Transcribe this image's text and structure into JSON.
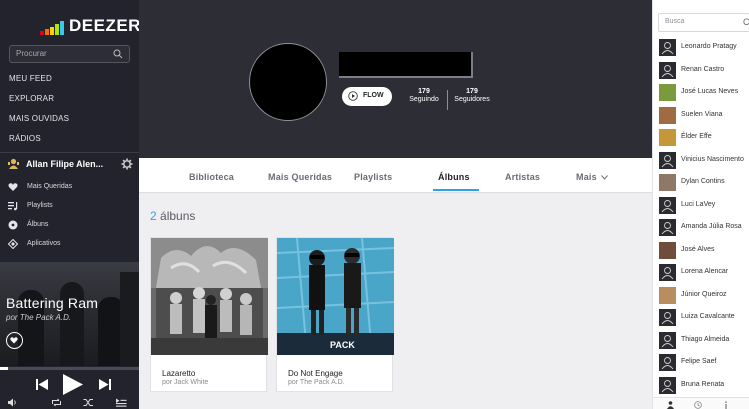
{
  "app": {
    "logo_text": "DEEZER"
  },
  "sidebar": {
    "search_placeholder": "Procurar",
    "nav": [
      "MEU FEED",
      "EXPLORAR",
      "MAIS OUVIDAS",
      "RÁDIOS"
    ],
    "user_name": "Allan Filipe Alen...",
    "library": [
      {
        "label": "Mais Queridas",
        "icon": "heart-icon"
      },
      {
        "label": "Playlists",
        "icon": "playlist-icon"
      },
      {
        "label": "Álbuns",
        "icon": "album-icon"
      },
      {
        "label": "Aplicativos",
        "icon": "apps-icon"
      }
    ]
  },
  "player": {
    "track_title": "Battering Ram",
    "track_artist": "por The Pack A.D.",
    "progress_fraction": 0.06
  },
  "profile": {
    "flow_label": "FLOW",
    "following_count": "179",
    "following_label": "Seguindo",
    "followers_count": "179",
    "followers_label": "Seguidores"
  },
  "tabs": [
    {
      "label": "Biblioteca",
      "active": false
    },
    {
      "label": "Mais Queridas",
      "active": false
    },
    {
      "label": "Playlists",
      "active": false
    },
    {
      "label": "Álbuns",
      "active": true
    },
    {
      "label": "Artistas",
      "active": false
    },
    {
      "label": "Mais",
      "active": false
    }
  ],
  "albums_section": {
    "count_number": "2",
    "count_label": " álbuns"
  },
  "albums": [
    {
      "title": "Lazaretto",
      "artist": "por Jack White"
    },
    {
      "title": "Do Not Engage",
      "artist": "por The Pack A.D.",
      "cover_text": "PACK"
    }
  ],
  "right_panel": {
    "search_placeholder": "Busca",
    "search_trailing": "C",
    "friends": [
      "Leonardo Pratagy",
      "Renan Castro",
      "José Lucas Neves",
      "Suelen Viana",
      "Élder Effe",
      "Vinicius Nascimento",
      "Dylan Contins",
      "Luci LaVey",
      "Amanda Júlia Rosa",
      "José Alves",
      "Lorena Alencar",
      "Júnior Queiroz",
      "Luiza Cavalcante",
      "Thiago Almeida",
      "Felipe Saef",
      "Bruna Renata"
    ]
  },
  "colors": {
    "accent": "#2fa3e6",
    "sidebar_bg": "#23232d",
    "banner_bg": "#2d2e35"
  }
}
